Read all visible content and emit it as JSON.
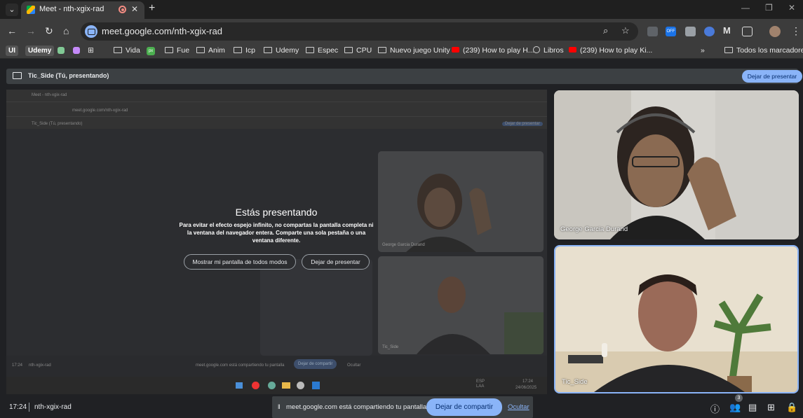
{
  "browser": {
    "tab_title": "Meet - nth-xgix-rad",
    "url": "meet.google.com/nth-xgix-rad",
    "bookmarks": [
      {
        "label": "UI",
        "type": "chip"
      },
      {
        "label": "Udemy",
        "type": "chip"
      },
      {
        "label": "Vida",
        "type": "folder"
      },
      {
        "label": "Fue",
        "type": "folder"
      },
      {
        "label": "Anim",
        "type": "folder"
      },
      {
        "label": "Icp",
        "type": "folder"
      },
      {
        "label": "Udemy",
        "type": "folder"
      },
      {
        "label": "Espec",
        "type": "folder"
      },
      {
        "label": "CPU",
        "type": "folder"
      },
      {
        "label": "Nuevo juego Unity",
        "type": "folder"
      },
      {
        "label": "(239) How to play H...",
        "type": "youtube"
      },
      {
        "label": "Libros",
        "type": "web"
      },
      {
        "label": "(239) How to play Ki...",
        "type": "youtube"
      }
    ],
    "all_bookmarks": "Todos los marcadores",
    "ext_off_label": "OFF"
  },
  "meet": {
    "presenting_banner": "Tic_Side (Tú, presentando)",
    "stop_presenting": "Dejar de presentar",
    "overlay": {
      "title": "Estás presentando",
      "body": "Para evitar el efecto espejo infinito, no compartas la pantalla completa ni la ventana del navegador entera. Comparte una sola pestaña o una ventana diferente.",
      "show_anyway": "Mostrar mi pantalla de todos modos",
      "stop": "Dejar de presentar"
    },
    "participants": [
      {
        "name": "George Garcia Durand"
      },
      {
        "name": "Tic_Side"
      }
    ],
    "time": "17:24",
    "meeting_code": "nth-xgix-rad",
    "share_notice": "meet.google.com está compartiendo tu pantalla.",
    "stop_sharing": "Dejar de compartir",
    "hide": "Ocultar",
    "people_count": "3"
  },
  "mini": {
    "tab_title": "Meet - nth-xgix-rad",
    "url": "meet.google.com/nth-xgix-rad",
    "banner": "Tic_Side (Tú, presentando)",
    "stop": "Dejar de presentar",
    "george": "George Garcia Durand",
    "tic": "Tic_Side",
    "time": "17:24",
    "code": "nth-xgix-rad",
    "notice": "meet.google.com está compartiendo tu pantalla",
    "stop_sharing": "Dejar de compartir",
    "hide": "Ocultar",
    "clock": "17:24",
    "date": "24/06/2025",
    "lang": "ESP\nLAA"
  }
}
